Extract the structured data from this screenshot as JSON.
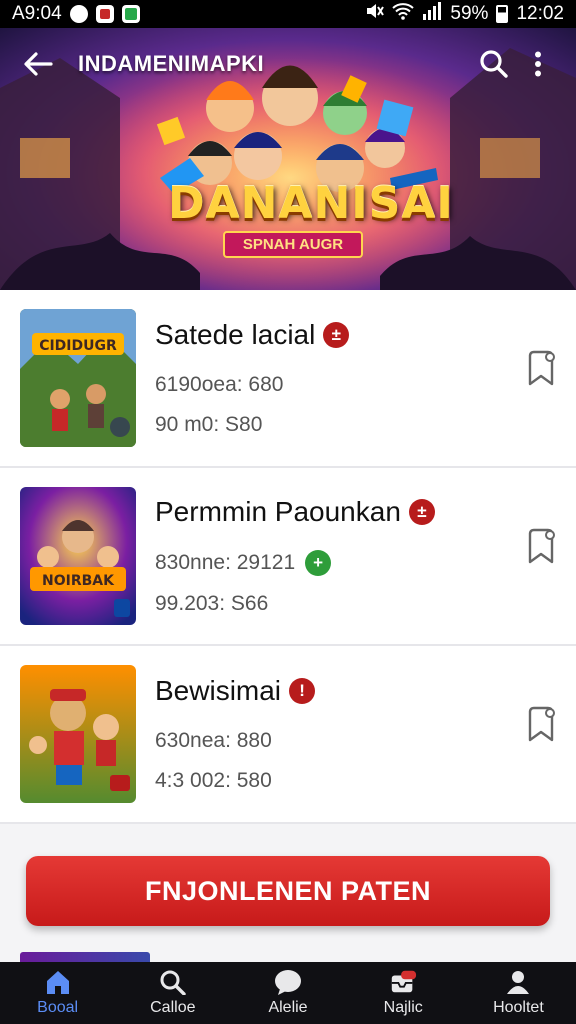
{
  "status_bar": {
    "time_left": "A9:04",
    "battery_percent": "59%",
    "time_right": "12:02",
    "icons": [
      "messenger-icon",
      "notification-icon",
      "app-icon",
      "mute-icon",
      "wifi-icon",
      "signal-icon",
      "battery-icon"
    ]
  },
  "header": {
    "title": "INDAMENIMAPKI",
    "back_icon": "arrow-left-icon",
    "search_icon": "search-icon",
    "more_icon": "more-vertical-icon"
  },
  "banner": {
    "logo_text": "DANANISAI",
    "logo_ribbon": "SPNAH AUGR"
  },
  "games": [
    {
      "title": "Satede lacial",
      "badge": "±",
      "badge_color": "#b71c1c",
      "meta1": "6190oea: 680",
      "meta2": "90 m0: S80",
      "thumb_text": "CIDIDUGR"
    },
    {
      "title": "Permmin Paounkan",
      "badge": "±",
      "badge_color": "#b71c1c",
      "meta1": "830nne: 29121",
      "meta1_badge": "+",
      "meta1_badge_color": "#2e9d3a",
      "meta2": "99.203: S66",
      "thumb_text": "NOIRBAK"
    },
    {
      "title": "Bewisimai",
      "badge": "!",
      "badge_color": "#b71c1c",
      "meta1": "630nea: 880",
      "meta2": "4:3 002: 580",
      "thumb_text": ""
    }
  ],
  "cta": {
    "label": "FNJONLENEN PATEN",
    "color": "#d32f2f"
  },
  "bottom_nav": [
    {
      "label": "Booal",
      "icon": "home-icon",
      "active": true
    },
    {
      "label": "Calloe",
      "icon": "search-icon",
      "active": false
    },
    {
      "label": "Alelie",
      "icon": "chat-bubble-icon",
      "active": false
    },
    {
      "label": "Najlic",
      "icon": "inbox-icon",
      "active": false
    },
    {
      "label": "Hooltet",
      "icon": "profile-icon",
      "active": false
    }
  ],
  "accent_color": "#5b8df5"
}
